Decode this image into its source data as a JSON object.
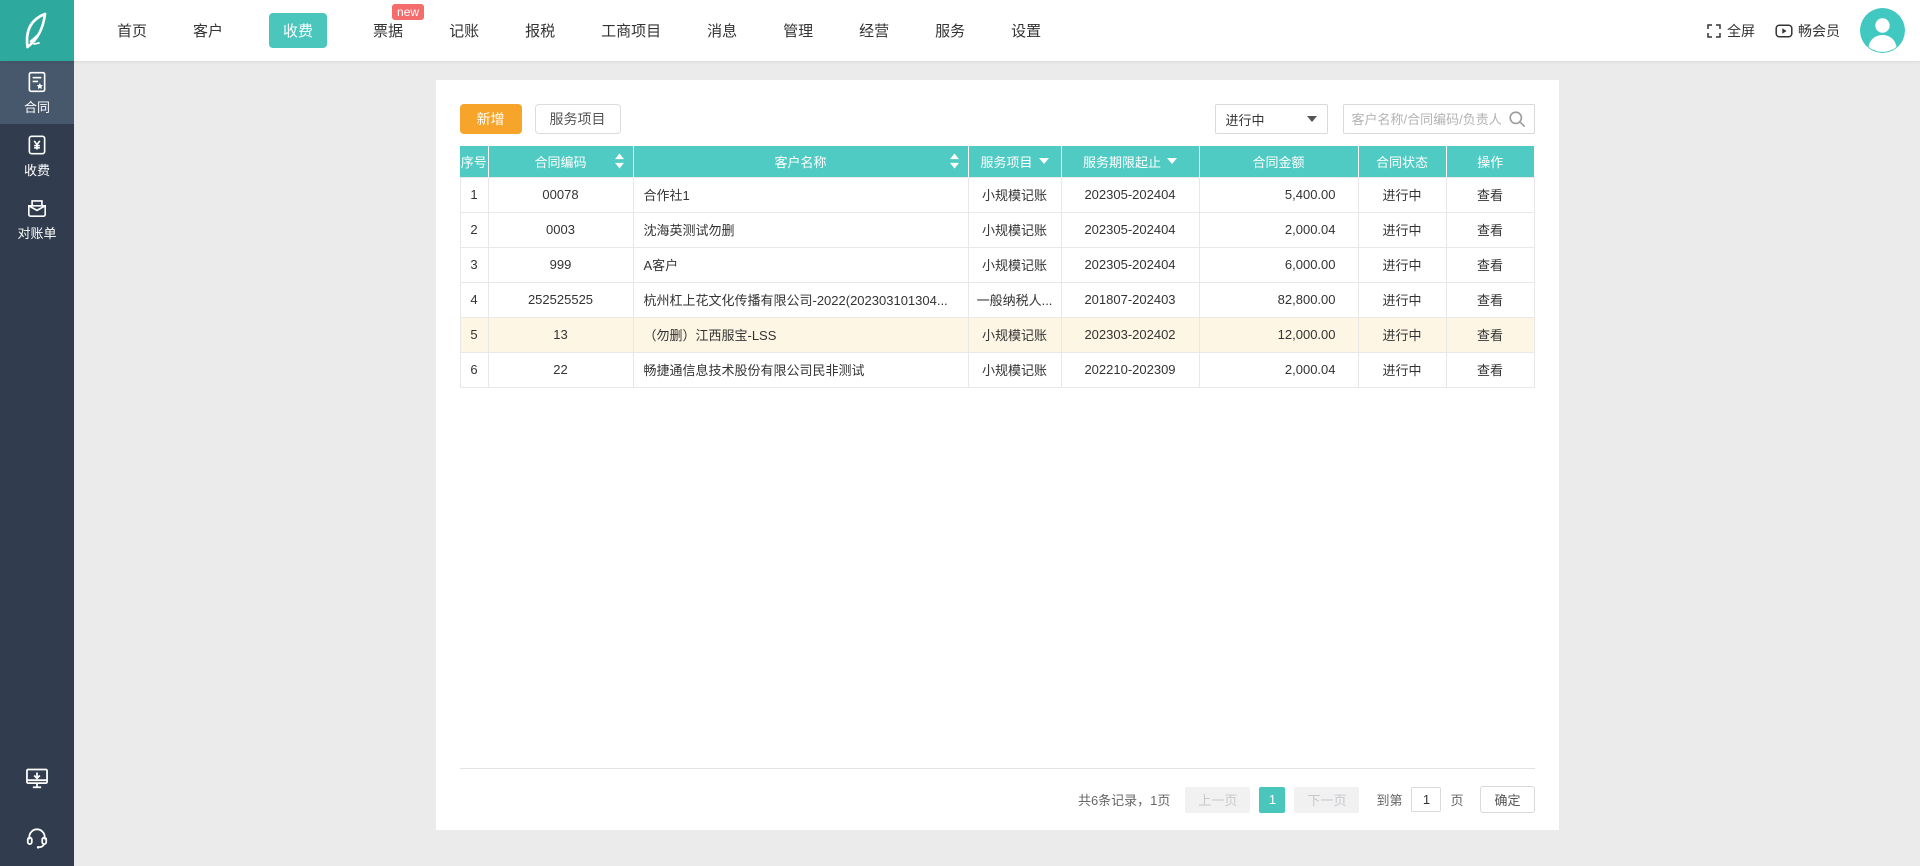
{
  "topbar": {
    "fullscreen_label": "全屏",
    "member_label": "畅会员",
    "nav_items": [
      {
        "id": "home",
        "label": "首页"
      },
      {
        "id": "customers",
        "label": "客户"
      },
      {
        "id": "fees",
        "label": "收费",
        "active": true
      },
      {
        "id": "invoices",
        "label": "票据",
        "badge": "new"
      },
      {
        "id": "bookkeeping",
        "label": "记账"
      },
      {
        "id": "tax-filing",
        "label": "报税"
      },
      {
        "id": "business-projects",
        "label": "工商项目"
      },
      {
        "id": "messages",
        "label": "消息"
      },
      {
        "id": "management",
        "label": "管理"
      },
      {
        "id": "operations",
        "label": "经营"
      },
      {
        "id": "services",
        "label": "服务"
      },
      {
        "id": "settings",
        "label": "设置"
      }
    ]
  },
  "sidebar": {
    "items": [
      {
        "id": "contracts",
        "label": "合同",
        "active": true
      },
      {
        "id": "fees",
        "label": "收费"
      },
      {
        "id": "statements",
        "label": "对账单"
      }
    ]
  },
  "toolbar": {
    "add_label": "新增",
    "service_items_label": "服务项目",
    "status_filter_value": "进行中",
    "search_placeholder": "客户名称/合同编码/负责人"
  },
  "table": {
    "columns": [
      {
        "label": "序号"
      },
      {
        "label": "合同编码",
        "sort": true
      },
      {
        "label": "客户名称",
        "sort": true
      },
      {
        "label": "服务项目",
        "filter": true
      },
      {
        "label": "服务期限起止",
        "filter": true
      },
      {
        "label": "合同金额"
      },
      {
        "label": "合同状态"
      },
      {
        "label": "操作"
      }
    ],
    "rows": [
      {
        "seq": "1",
        "code": "00078",
        "customer": "合作社1",
        "service": "小规模记账",
        "period": "202305-202404",
        "amount": "5,400.00",
        "status": "进行中",
        "action": "查看"
      },
      {
        "seq": "2",
        "code": "0003",
        "customer": "沈海英测试勿删",
        "service": "小规模记账",
        "period": "202305-202404",
        "amount": "2,000.04",
        "status": "进行中",
        "action": "查看"
      },
      {
        "seq": "3",
        "code": "999",
        "customer": "A客户",
        "service": "小规模记账",
        "period": "202305-202404",
        "amount": "6,000.00",
        "status": "进行中",
        "action": "查看"
      },
      {
        "seq": "4",
        "code": "252525525",
        "customer": "杭州杠上花文化传播有限公司-2022(202303101304...",
        "service": "一般纳税人...",
        "period": "201807-202403",
        "amount": "82,800.00",
        "status": "进行中",
        "action": "查看"
      },
      {
        "seq": "5",
        "code": "13",
        "customer": "（勿删）江西服宝-LSS",
        "service": "小规模记账",
        "period": "202303-202402",
        "amount": "12,000.00",
        "status": "进行中",
        "action": "查看",
        "highlight": true
      },
      {
        "seq": "6",
        "code": "22",
        "customer": "畅捷通信息技术股份有限公司民非测试",
        "service": "小规模记账",
        "period": "202210-202309",
        "amount": "2,000.04",
        "status": "进行中",
        "action": "查看"
      }
    ]
  },
  "pagination": {
    "summary": "共6条记录，1页",
    "prev_label": "上一页",
    "current_page": "1",
    "next_label": "下一页",
    "goto_label": "到第",
    "goto_value": "1",
    "page_unit": "页",
    "confirm_label": "确定"
  },
  "colors": {
    "brand_teal": "#4ac6bd",
    "logo_teal": "#2ea99e",
    "table_header_teal": "#50cbc3",
    "sidebar_bg": "#313d4e",
    "sidebar_active_bg": "#47586c",
    "accent_orange": "#f7a42b",
    "badge_red": "#f56c6c",
    "row_highlight": "#fdf6e4"
  }
}
